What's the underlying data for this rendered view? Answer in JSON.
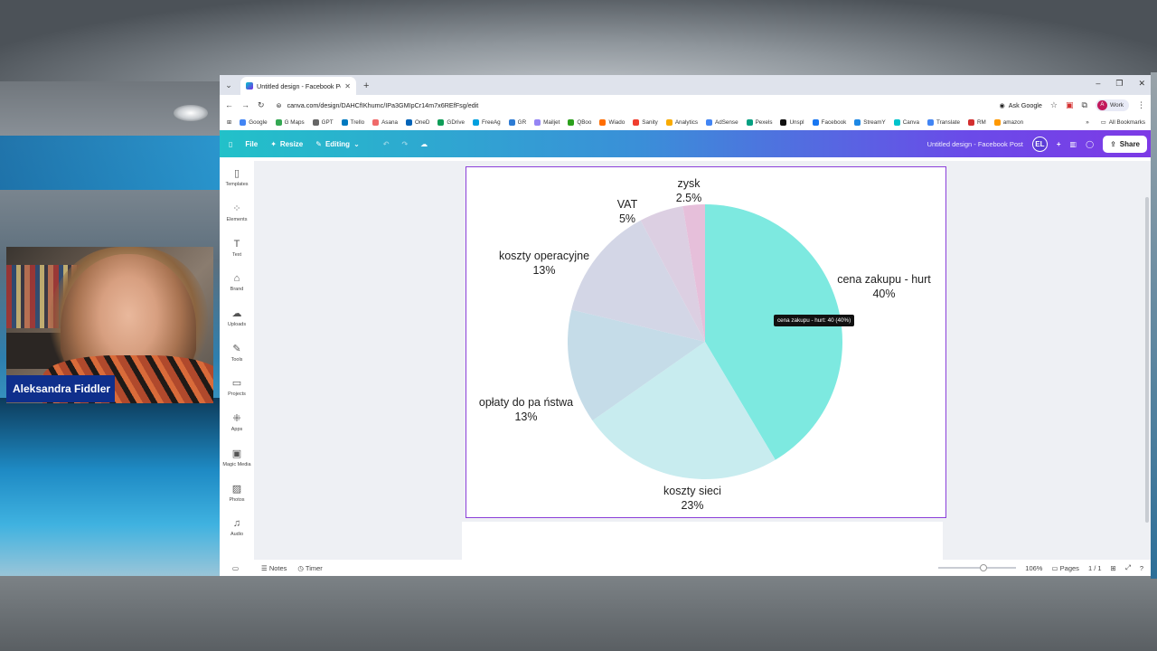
{
  "webcam": {
    "name": "Aleksandra Fiddler"
  },
  "browser": {
    "tab_title": "Untitled design - Facebook Pos",
    "url": "canva.com/design/DAHCfIKhumc/IPa3GMIpCr14m7x6REfFsg/edit",
    "ask_google": "Ask Google",
    "profile_label": "Work",
    "profile_initial": "A",
    "bookmarks": [
      {
        "label": "Google",
        "color": "#4285f4"
      },
      {
        "label": "G Maps",
        "color": "#34a853"
      },
      {
        "label": "GPT",
        "color": "#666666"
      },
      {
        "label": "Trello",
        "color": "#0079bf"
      },
      {
        "label": "Asana",
        "color": "#f06a6a"
      },
      {
        "label": "OneD",
        "color": "#0364b8"
      },
      {
        "label": "GDrive",
        "color": "#0f9d58"
      },
      {
        "label": "FreeAg",
        "color": "#00a0df"
      },
      {
        "label": "GR",
        "color": "#2d7bd4"
      },
      {
        "label": "Mailjet",
        "color": "#9585f4"
      },
      {
        "label": "QBoo",
        "color": "#2ca01c"
      },
      {
        "label": "Wiado",
        "color": "#ff6d00"
      },
      {
        "label": "Sanity",
        "color": "#f03e2f"
      },
      {
        "label": "Analytics",
        "color": "#f9ab00"
      },
      {
        "label": "AdSense",
        "color": "#4285f4"
      },
      {
        "label": "Pexels",
        "color": "#05a081"
      },
      {
        "label": "Unspl",
        "color": "#111111"
      },
      {
        "label": "Facebook",
        "color": "#1877f2"
      },
      {
        "label": "StreamY",
        "color": "#1e88e5"
      },
      {
        "label": "Canva",
        "color": "#00c4cc"
      },
      {
        "label": "Translate",
        "color": "#4285f4"
      },
      {
        "label": "RM",
        "color": "#d32f2f"
      },
      {
        "label": "amazon",
        "color": "#ff9900"
      }
    ],
    "bookmarks_more": "»",
    "all_bookmarks": "All Bookmarks"
  },
  "canva_header": {
    "file": "File",
    "resize": "Resize",
    "editing": "Editing",
    "design_title": "Untitled design - Facebook Post",
    "avatar": "EL",
    "share": "Share"
  },
  "sidebar": [
    {
      "label": "Templates",
      "icon": "▯"
    },
    {
      "label": "Elements",
      "icon": "⁘"
    },
    {
      "label": "Text",
      "icon": "T"
    },
    {
      "label": "Brand",
      "icon": "⌂"
    },
    {
      "label": "Uploads",
      "icon": "☁"
    },
    {
      "label": "Tools",
      "icon": "✎"
    },
    {
      "label": "Projects",
      "icon": "▭"
    },
    {
      "label": "Apps",
      "icon": "⁜"
    },
    {
      "label": "Magic Media",
      "icon": "▣"
    },
    {
      "label": "Photos",
      "icon": "▨"
    },
    {
      "label": "Audio",
      "icon": "♫"
    }
  ],
  "chart_data": {
    "type": "pie",
    "slices": [
      {
        "label": "cena zakupu - hurt",
        "pct_label": "40%",
        "value": 40,
        "color": "#7de9e0"
      },
      {
        "label": "koszty sieci",
        "pct_label": "23%",
        "value": 23,
        "color": "#c8ecef"
      },
      {
        "label": "opłaty do pa ństwa",
        "pct_label": "13%",
        "value": 13,
        "color": "#c5dce8"
      },
      {
        "label": "koszty operacyjne",
        "pct_label": "13%",
        "value": 13,
        "color": "#d3d6e6"
      },
      {
        "label": "VAT",
        "pct_label": "5%",
        "value": 5,
        "color": "#dccfe2"
      },
      {
        "label": "zysk",
        "pct_label": "2.5%",
        "value": 2.5,
        "color": "#e6bfda"
      }
    ],
    "tooltip": "cena zakupu - hurt: 40 (40%)"
  },
  "footer": {
    "notes": "Notes",
    "timer": "Timer",
    "zoom": "106%",
    "pages_label": "Pages",
    "pages_value": "1 / 1"
  }
}
